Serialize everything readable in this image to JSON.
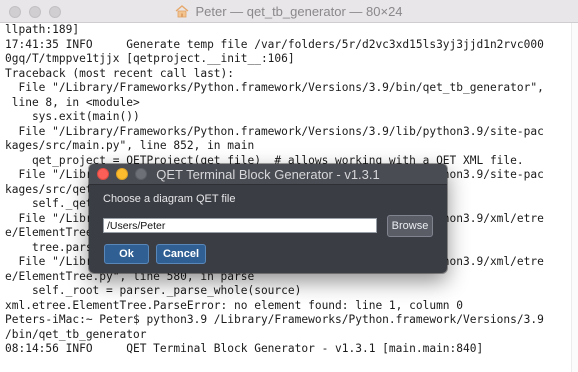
{
  "window": {
    "title": "Peter — qet_tb_generator — 80×24",
    "title_icon": "home-folder-icon"
  },
  "terminal": {
    "lines": [
      "llpath:189]",
      "17:41:35 INFO     Generate temp file /var/folders/5r/d2vc3xd15ls3yj3jjd1n2rvc000",
      "0gq/T/tmppve1tjjx [qetproject.__init__:106]",
      "Traceback (most recent call last):",
      "  File \"/Library/Frameworks/Python.framework/Versions/3.9/bin/qet_tb_generator\",",
      " line 8, in <module>",
      "    sys.exit(main())",
      "  File \"/Library/Frameworks/Python.framework/Versions/3.9/lib/python3.9/site-pac",
      "kages/src/main.py\", line 852, in main",
      "    qet_project = QETProject(qet_file)  # allows working with a QET XML file.",
      "  File \"/Library/Frameworks/Python.framework/Versions/3.9/lib/python3.9/site-pac",
      "kages/src/qetproject.py\", line 108, in __init__",
      "    self._qet_tree = ET.parse(self.qet_project_file)",
      "  File \"/Library/Frameworks/Python.framework/Versions/3.9/lib/python3.9/xml/etre",
      "e/ElementTree.py\", line 1229, in parse",
      "    tree.parse(source, parser)",
      "  File \"/Library/Frameworks/Python.framework/Versions/3.9/lib/python3.9/xml/etre",
      "e/ElementTree.py\", line 580, in parse",
      "    self._root = parser._parse_whole(source)",
      "xml.etree.ElementTree.ParseError: no element found: line 1, column 0",
      "Peters-iMac:~ Peter$ python3.9 /Library/Frameworks/Python.framework/Versions/3.9",
      "/bin/qet_tb_generator",
      "08:14:56 INFO     QET Terminal Block Generator - v1.3.1 [main.main:840]",
      ""
    ]
  },
  "dialog": {
    "title": "QET Terminal Block Generator - v1.3.1",
    "label": "Choose a diagram QET file",
    "path_value": "/Users/Peter",
    "browse_label": "Browse",
    "ok_label": "Ok",
    "cancel_label": "Cancel"
  },
  "colors": {
    "terminal_bg": "#ffffff",
    "terminal_text": "#1b1b1b",
    "dialog_bg": "#3b3d44",
    "button_blue": "#2f5f93"
  }
}
